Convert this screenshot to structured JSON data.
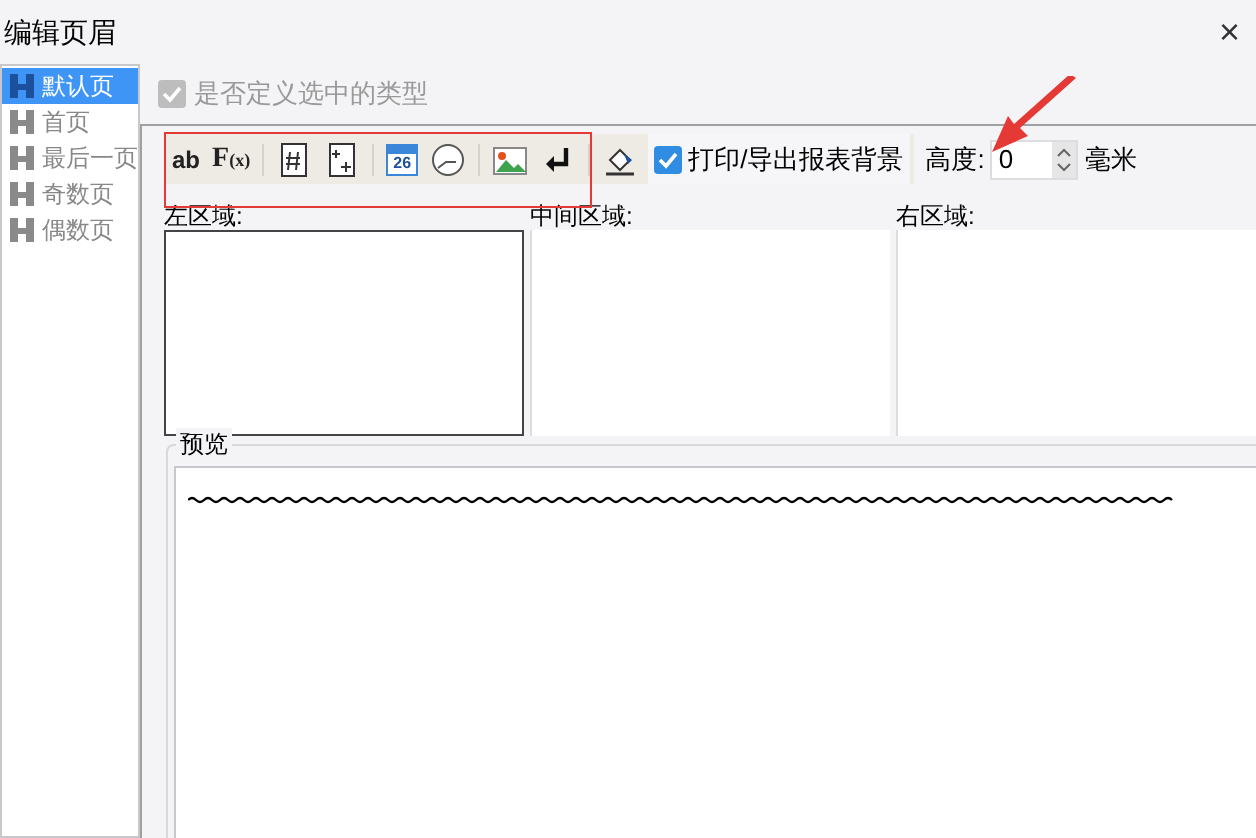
{
  "window": {
    "title": "编辑页眉",
    "close": "×"
  },
  "sidebar": {
    "items": [
      {
        "label": "默认页",
        "selected": true
      },
      {
        "label": "首页",
        "selected": false
      },
      {
        "label": "最后一页",
        "selected": false
      },
      {
        "label": "奇数页",
        "selected": false
      },
      {
        "label": "偶数页",
        "selected": false
      }
    ]
  },
  "custom_type": {
    "label": "是否定义选中的类型",
    "checked": true,
    "disabled": true
  },
  "toolbar": {
    "items": [
      {
        "kind": "text",
        "label": "ab"
      },
      {
        "kind": "formula",
        "label": "F",
        "sub": "(x)"
      },
      {
        "kind": "separator"
      },
      {
        "kind": "page-number"
      },
      {
        "kind": "total-pages"
      },
      {
        "kind": "separator"
      },
      {
        "kind": "date",
        "label": "26"
      },
      {
        "kind": "clock"
      },
      {
        "kind": "separator"
      },
      {
        "kind": "image"
      },
      {
        "kind": "newline"
      },
      {
        "kind": "separator"
      },
      {
        "kind": "background"
      }
    ],
    "print_background": {
      "label": "打印/导出报表背景",
      "checked": true
    },
    "height": {
      "label": "高度:",
      "value": "0",
      "unit": "毫米"
    }
  },
  "regions": [
    {
      "label": "左区域:",
      "selected": true
    },
    {
      "label": "中间区域:",
      "selected": false
    },
    {
      "label": "右区域:",
      "selected": false
    }
  ],
  "preview": {
    "label": "预览"
  }
}
